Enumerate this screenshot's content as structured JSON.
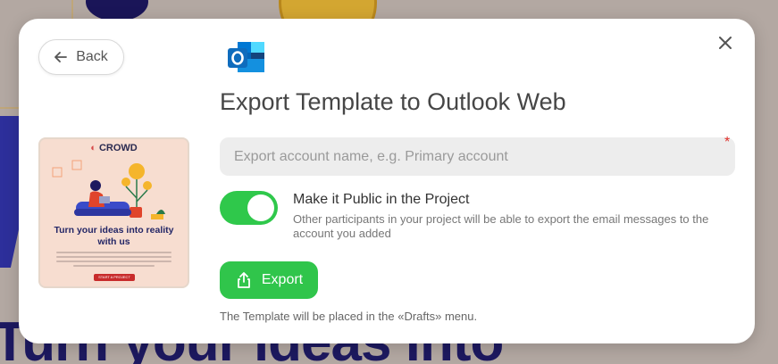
{
  "modal": {
    "back_label": "Back",
    "title": "Export Template to Outlook Web",
    "account_input": {
      "placeholder": "Export account name, e.g. Primary account",
      "value": "",
      "required_mark": "*"
    },
    "public_toggle": {
      "enabled": true,
      "title": "Make it Public in the Project",
      "description": "Other participants in your project will be able to export the email messages to the account you added"
    },
    "export_label": "Export",
    "note": "The Template will be placed in the «Drafts» menu."
  },
  "thumbnail": {
    "brand": "CROWD",
    "heading": "Turn your ideas into reality with us",
    "cta": "START A PROJECT"
  },
  "background": {
    "heading": "Turn your ideas into"
  },
  "colors": {
    "accent_green": "#30c54b",
    "required_red": "#e0302b",
    "outlook_blue": "#0f6cbd"
  },
  "icons": {
    "back": "arrow-left-icon",
    "close": "close-icon",
    "app": "outlook-icon",
    "export": "share-upload-icon"
  }
}
